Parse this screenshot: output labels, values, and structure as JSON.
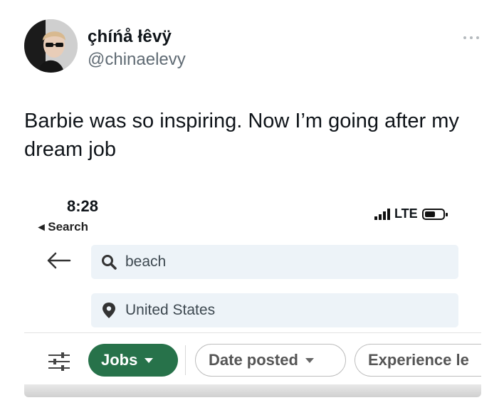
{
  "tweet": {
    "display_name": "çhíńå łêvÿ",
    "handle": "@chinaelevy",
    "text": "Barbie was so inspiring. Now I’m going after my dream job"
  },
  "screenshot": {
    "status_bar": {
      "time": "8:28",
      "back_label": "◂ Search",
      "network": "LTE"
    },
    "search": {
      "query": "beach",
      "location": "United States"
    },
    "filters": {
      "jobs_label": "Jobs",
      "date_posted_label": "Date posted",
      "experience_label": "Experience le"
    }
  },
  "icons": [
    "avatar",
    "more-icon",
    "back-arrow-icon",
    "search-icon",
    "location-pin-icon",
    "filters-icon",
    "signal-icon",
    "battery-icon",
    "caret-down-icon"
  ],
  "colors": {
    "jobs_chip": "#27724a",
    "field_bg": "#edf3f8",
    "handle": "#5f6a73"
  }
}
